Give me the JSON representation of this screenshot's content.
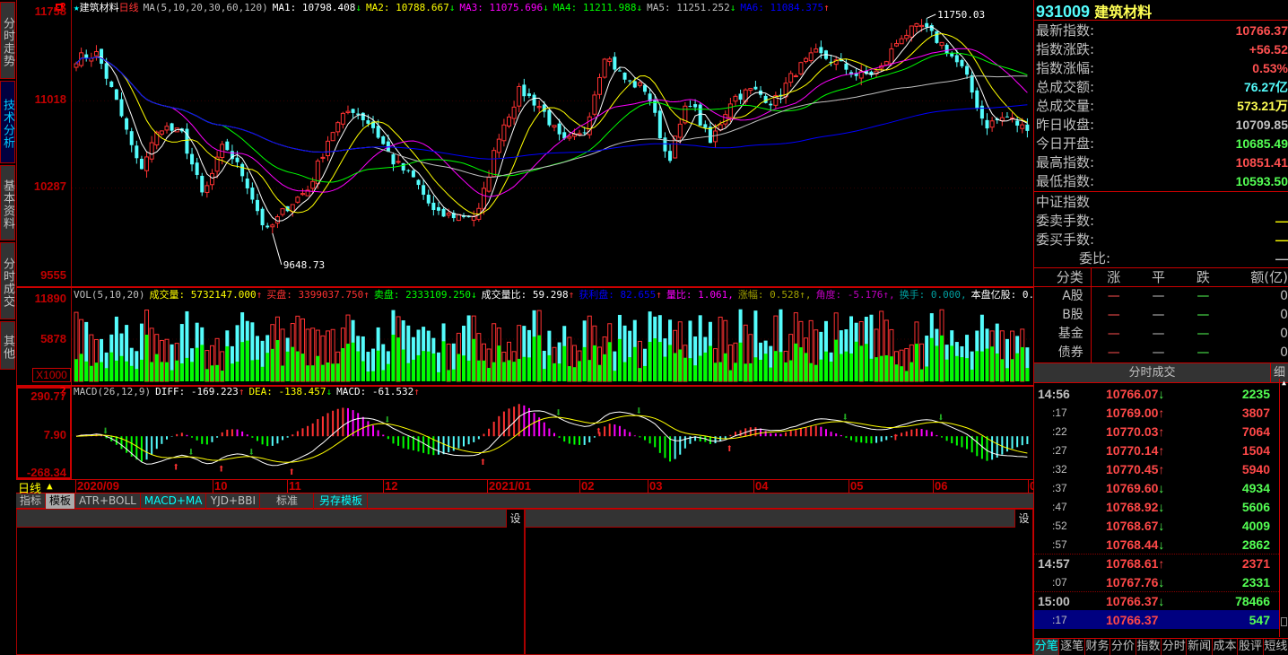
{
  "left_tabs": [
    {
      "label": "分时走势"
    },
    {
      "label": "技术分析",
      "active": true
    },
    {
      "label": "基本资料"
    },
    {
      "label": "分时成交"
    },
    {
      "label": "其他"
    }
  ],
  "main_chart": {
    "star": "★",
    "name": "建筑材料",
    "period": "日线",
    "ma_params": "MA(5,10,20,30,60,120)",
    "ma": [
      {
        "label": "MA1: 10798.408",
        "dir": "↓",
        "color": "#ffffff"
      },
      {
        "label": "MA2: 10788.667",
        "dir": "↓",
        "color": "#ffff00"
      },
      {
        "label": "MA3: 11075.696",
        "dir": "↓",
        "color": "#ff00ff"
      },
      {
        "label": "MA4: 11211.988",
        "dir": "↓",
        "color": "#00ff00"
      },
      {
        "label": "MA5: 11251.252",
        "dir": "↓",
        "color": "#c0c0c0"
      },
      {
        "label": "MA6: 11084.375",
        "dir": "↑",
        "color": "#0000ff"
      }
    ],
    "price_ticks": [
      "11758",
      "11018",
      "10287",
      "9555"
    ],
    "high_marker": "11750.03",
    "low_marker": "9648.73"
  },
  "volume_chart": {
    "params": "VOL(5,10,20)",
    "items": [
      {
        "label": "成交量: 5732147.000",
        "dir": "↑",
        "color": "#ffff00"
      },
      {
        "label": "买盘: 3399037.750",
        "dir": "↑",
        "color": "#ff3232"
      },
      {
        "label": "卖盘: 2333109.250",
        "dir": "↓",
        "color": "#00ff00"
      },
      {
        "label": "成交量比: 59.298",
        "dir": "↑",
        "color": "#ffffff"
      },
      {
        "label": "获利盘: 82.655",
        "dir": "↑",
        "color": "#0000ff"
      },
      {
        "label": "量比: 1.061,",
        "dir": "",
        "color": "#ff00ff"
      },
      {
        "label": "涨幅: 0.528↑,",
        "dir": "",
        "color": "#a0a000"
      },
      {
        "label": "角度: -5.176↑,",
        "dir": "",
        "color": "#c000c0"
      },
      {
        "label": "换手: 0.000,",
        "dir": "",
        "color": "#00a0a0"
      },
      {
        "label": "本盘亿股: 0.000",
        "dir": "",
        "color": "#ffffff"
      }
    ],
    "ticks": [
      "11890",
      "5878"
    ],
    "unit": "X1000"
  },
  "macd_chart": {
    "params": "MACD(26,12,9)",
    "items": [
      {
        "label": "DIFF: -169.223",
        "dir": "↑",
        "color": "#ffffff"
      },
      {
        "label": "DEA: -138.457",
        "dir": "↓",
        "color": "#ffff00"
      },
      {
        "label": "MACD: -61.532",
        "dir": "↑",
        "color": "#ffffff"
      }
    ],
    "ticks": [
      "290.77",
      "7.90",
      "-268.34"
    ],
    "help": "?"
  },
  "chart_data": {
    "type": "candlestick",
    "period": "daily",
    "close_anchors": [
      11374,
      11412,
      10961,
      10434,
      10810,
      10735,
      10209,
      10660,
      10359,
      9908,
      10134,
      10284,
      10735,
      10961,
      10810,
      10510,
      10359,
      10058,
      10058,
      10058,
      10735,
      11111,
      10961,
      10660,
      10735,
      11412,
      11186,
      11111,
      10510,
      11036,
      10660,
      11036,
      11111,
      11000,
      11262,
      11412,
      11337,
      11224,
      11262,
      11562,
      11638,
      11487,
      11262,
      10810,
      10886,
      10766.37
    ],
    "ylim": [
      9555,
      11758
    ],
    "date_ticks": [
      "2020/09",
      "10",
      "11",
      "12",
      "2021/01",
      "02",
      "03",
      "04",
      "05",
      "06",
      "0"
    ]
  },
  "axis": {
    "period_label": "日线",
    "arrow": "▲"
  },
  "template_bar": {
    "items": [
      "指标",
      "模板",
      "ATR+BOLL",
      "MACD+MA",
      "YJD+BBI",
      "标准",
      "另存模板"
    ]
  },
  "bottom_panels": {
    "set_label": "设"
  },
  "quote": {
    "code": "931009",
    "name": "建筑材料",
    "rows": [
      {
        "label": "最新指数:",
        "value": "10766.37",
        "color": "#ff5050"
      },
      {
        "label": "指数涨跌:",
        "value": "+56.52",
        "color": "#ff5050"
      },
      {
        "label": "指数涨幅:",
        "value": "0.53%",
        "color": "#ff5050"
      },
      {
        "label": "总成交额:",
        "value": "76.27亿",
        "color": "#54fcfc"
      },
      {
        "label": "总成交量:",
        "value": "573.21万",
        "color": "#ffff54"
      },
      {
        "label": "昨日收盘:",
        "value": "10709.85",
        "color": "#c0c0c0"
      },
      {
        "label": "今日开盘:",
        "value": "10685.49",
        "color": "#54ff54"
      },
      {
        "label": "最高指数:",
        "value": "10851.41",
        "color": "#ff5050"
      },
      {
        "label": "最低指数:",
        "value": "10593.50",
        "color": "#54ff54"
      }
    ],
    "section2_title": "中证指数",
    "rows2": [
      {
        "label": "委卖手数:",
        "value": "—",
        "color": "#ffff00"
      },
      {
        "label": "委买手数:",
        "value": "—",
        "color": "#ffff00"
      },
      {
        "label": "委比:",
        "value": "—",
        "color": "#c0c0c0"
      }
    ],
    "cat_headers": [
      "分类",
      "涨",
      "平",
      "跌",
      "额(亿)"
    ],
    "cats": [
      {
        "name": "A股",
        "up": "—",
        "flat": "—",
        "down": "—",
        "amt": "0"
      },
      {
        "name": "B股",
        "up": "—",
        "flat": "—",
        "down": "—",
        "amt": "0"
      },
      {
        "name": "基金",
        "up": "—",
        "flat": "—",
        "down": "—",
        "amt": "0"
      },
      {
        "name": "债券",
        "up": "—",
        "flat": "—",
        "down": "—",
        "amt": "0"
      }
    ]
  },
  "ticks_panel": {
    "title": "分时成交",
    "detail": "细",
    "rows": [
      {
        "time": "14:56",
        "price": "10766.07",
        "dir": "down",
        "vol": "2235"
      },
      {
        "time": ":17",
        "price": "10769.00",
        "dir": "up",
        "vol": "3807"
      },
      {
        "time": ":22",
        "price": "10770.03",
        "dir": "up",
        "vol": "7064"
      },
      {
        "time": ":27",
        "price": "10770.14",
        "dir": "up",
        "vol": "1504"
      },
      {
        "time": ":32",
        "price": "10770.45",
        "dir": "up",
        "vol": "5940"
      },
      {
        "time": ":37",
        "price": "10769.60",
        "dir": "down",
        "vol": "4934"
      },
      {
        "time": ":47",
        "price": "10768.92",
        "dir": "down",
        "vol": "5606"
      },
      {
        "time": ":52",
        "price": "10768.67",
        "dir": "down",
        "vol": "4009"
      },
      {
        "time": ":57",
        "price": "10768.44",
        "dir": "down",
        "vol": "2862"
      },
      {
        "time": "14:57",
        "price": "10768.61",
        "dir": "up",
        "vol": "2371"
      },
      {
        "time": ":07",
        "price": "10767.76",
        "dir": "down",
        "vol": "2331"
      },
      {
        "time": "15:00",
        "price": "10766.37",
        "dir": "down",
        "vol": "78466"
      },
      {
        "time": ":17",
        "price": "10766.37",
        "dir": "",
        "vol": "547",
        "selected": true
      }
    ],
    "bottom_tabs": [
      "分笔",
      "逐笔",
      "财务",
      "分价",
      "指数",
      "分时",
      "新闻",
      "成本",
      "股评",
      "短线"
    ]
  }
}
